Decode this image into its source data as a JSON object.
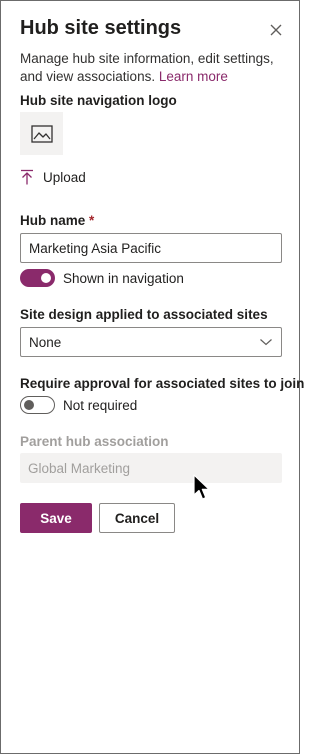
{
  "panel": {
    "title": "Hub site settings",
    "description": "Manage hub site information, edit settings, and view associations.",
    "learn_more_link": "Learn more"
  },
  "logo_section": {
    "label": "Hub site navigation logo",
    "icon": "image-placeholder-icon",
    "upload_label": "Upload",
    "upload_icon": "upload-arrow-icon"
  },
  "hub_name": {
    "label": "Hub name",
    "required_marker": "*",
    "value": "Marketing Asia Pacific"
  },
  "navigation_toggle": {
    "state": "on",
    "label": "Shown in navigation"
  },
  "site_design": {
    "label": "Site design applied to associated sites",
    "selected": "None",
    "icon": "chevron-down-icon"
  },
  "approval": {
    "label": "Require approval for associated sites to join",
    "toggle_state": "off",
    "toggle_label": "Not required"
  },
  "parent_hub": {
    "label": "Parent hub association",
    "value": "Global Marketing",
    "disabled": true
  },
  "actions": {
    "save_label": "Save",
    "cancel_label": "Cancel"
  },
  "colors": {
    "accent": "#8a2a6b",
    "text": "#201f1e",
    "disabled_text": "#a19f9d",
    "field_border": "#8a8886",
    "required": "#a4262c"
  }
}
